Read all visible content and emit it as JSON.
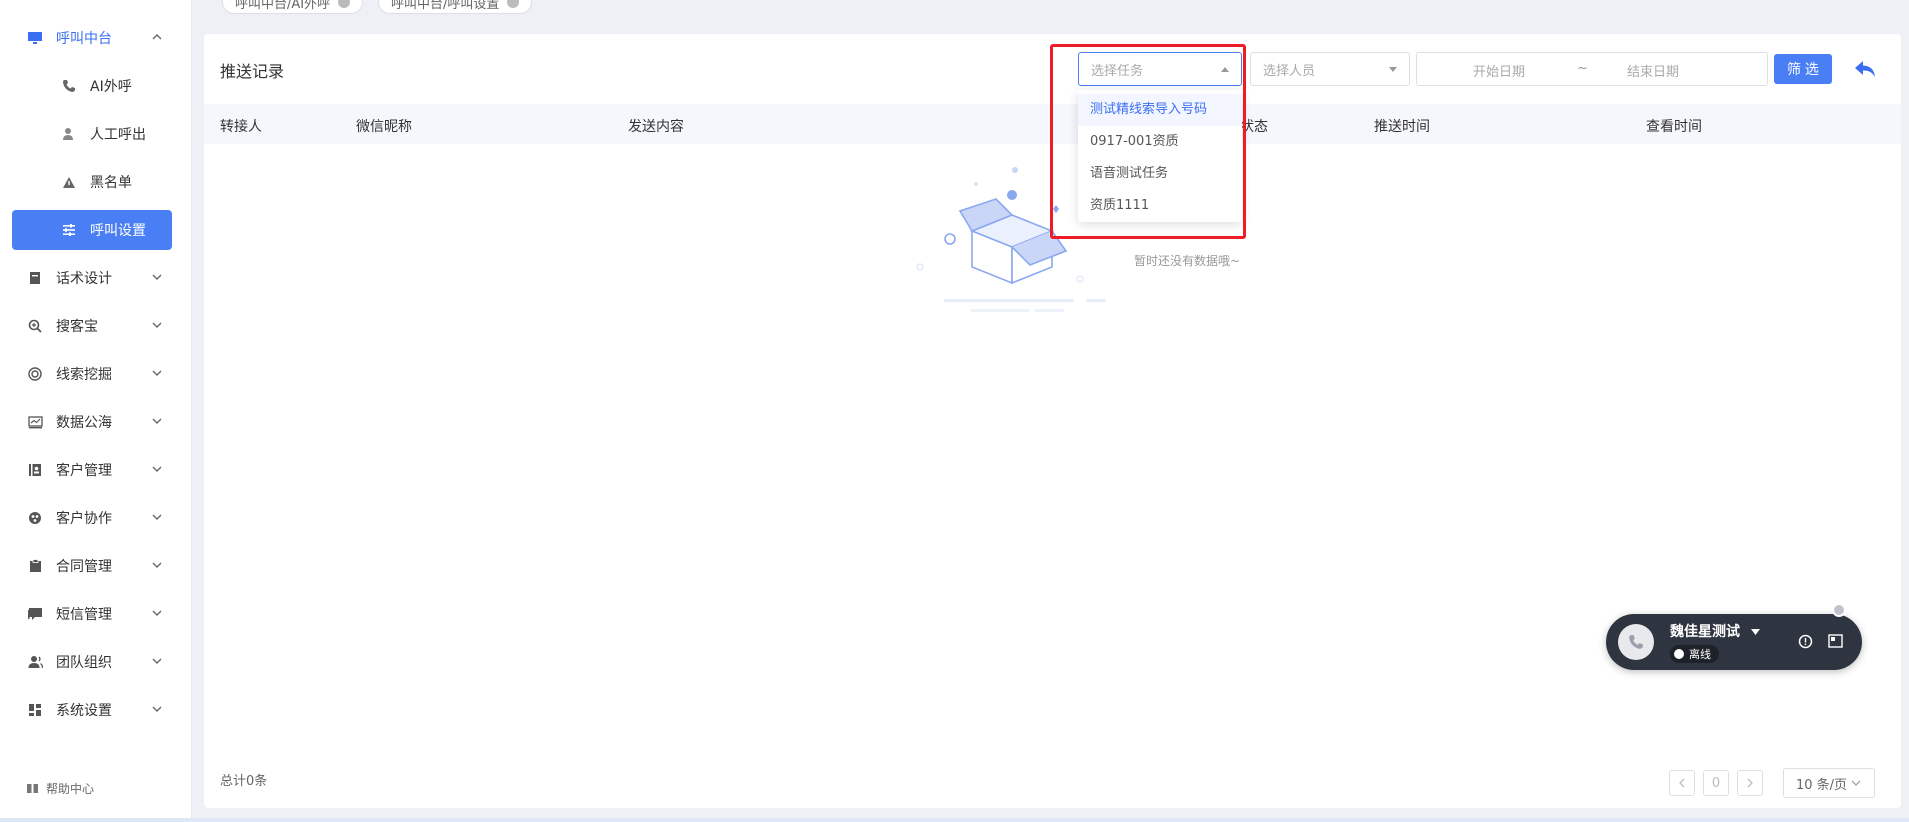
{
  "tabs": [
    {
      "label": "呼叫中台/AI外呼"
    },
    {
      "label": "呼叫中台/呼叫设置"
    }
  ],
  "sidebar": {
    "items": [
      {
        "label": "呼叫中台",
        "icon": "monitor-icon"
      },
      {
        "label": "AI外呼",
        "icon": "phone-icon"
      },
      {
        "label": "人工呼出",
        "icon": "user-icon"
      },
      {
        "label": "黑名单",
        "icon": "warning-icon"
      },
      {
        "label": "呼叫设置",
        "icon": "sliders-icon"
      },
      {
        "label": "话术设计",
        "icon": "book-icon"
      },
      {
        "label": "搜客宝",
        "icon": "search-plus-icon"
      },
      {
        "label": "线索挖掘",
        "icon": "target-icon"
      },
      {
        "label": "数据公海",
        "icon": "chart-icon"
      },
      {
        "label": "客户管理",
        "icon": "contacts-icon"
      },
      {
        "label": "客户协作",
        "icon": "collab-icon"
      },
      {
        "label": "合同管理",
        "icon": "clipboard-icon"
      },
      {
        "label": "短信管理",
        "icon": "message-icon"
      },
      {
        "label": "团队组织",
        "icon": "team-icon"
      },
      {
        "label": "系统设置",
        "icon": "grid-icon"
      }
    ],
    "help": "帮助中心"
  },
  "panel": {
    "title": "推送记录",
    "task_select_placeholder": "选择任务",
    "person_select_placeholder": "选择人员",
    "start_date_placeholder": "开始日期",
    "date_separator": "~",
    "end_date_placeholder": "结束日期",
    "filter_button": "筛 选",
    "columns": [
      "转接人",
      "微信昵称",
      "发送内容",
      "状态",
      "推送时间",
      "查看时间"
    ],
    "empty_text": "暂时还没有数据哦~",
    "total": "总计0条",
    "page_number": "0",
    "page_size": "10 条/页"
  },
  "dropdown": {
    "options": [
      "测试精线索导入号码",
      "0917-001资质",
      "语音测试任务",
      "资质1111"
    ],
    "selected_index": 0
  },
  "softphone": {
    "name": "魏佳星测试",
    "status": "离线"
  },
  "colors": {
    "accent": "#4a7ef5",
    "highlight": "#ee1c25",
    "phone_bg": "#2e3440"
  }
}
